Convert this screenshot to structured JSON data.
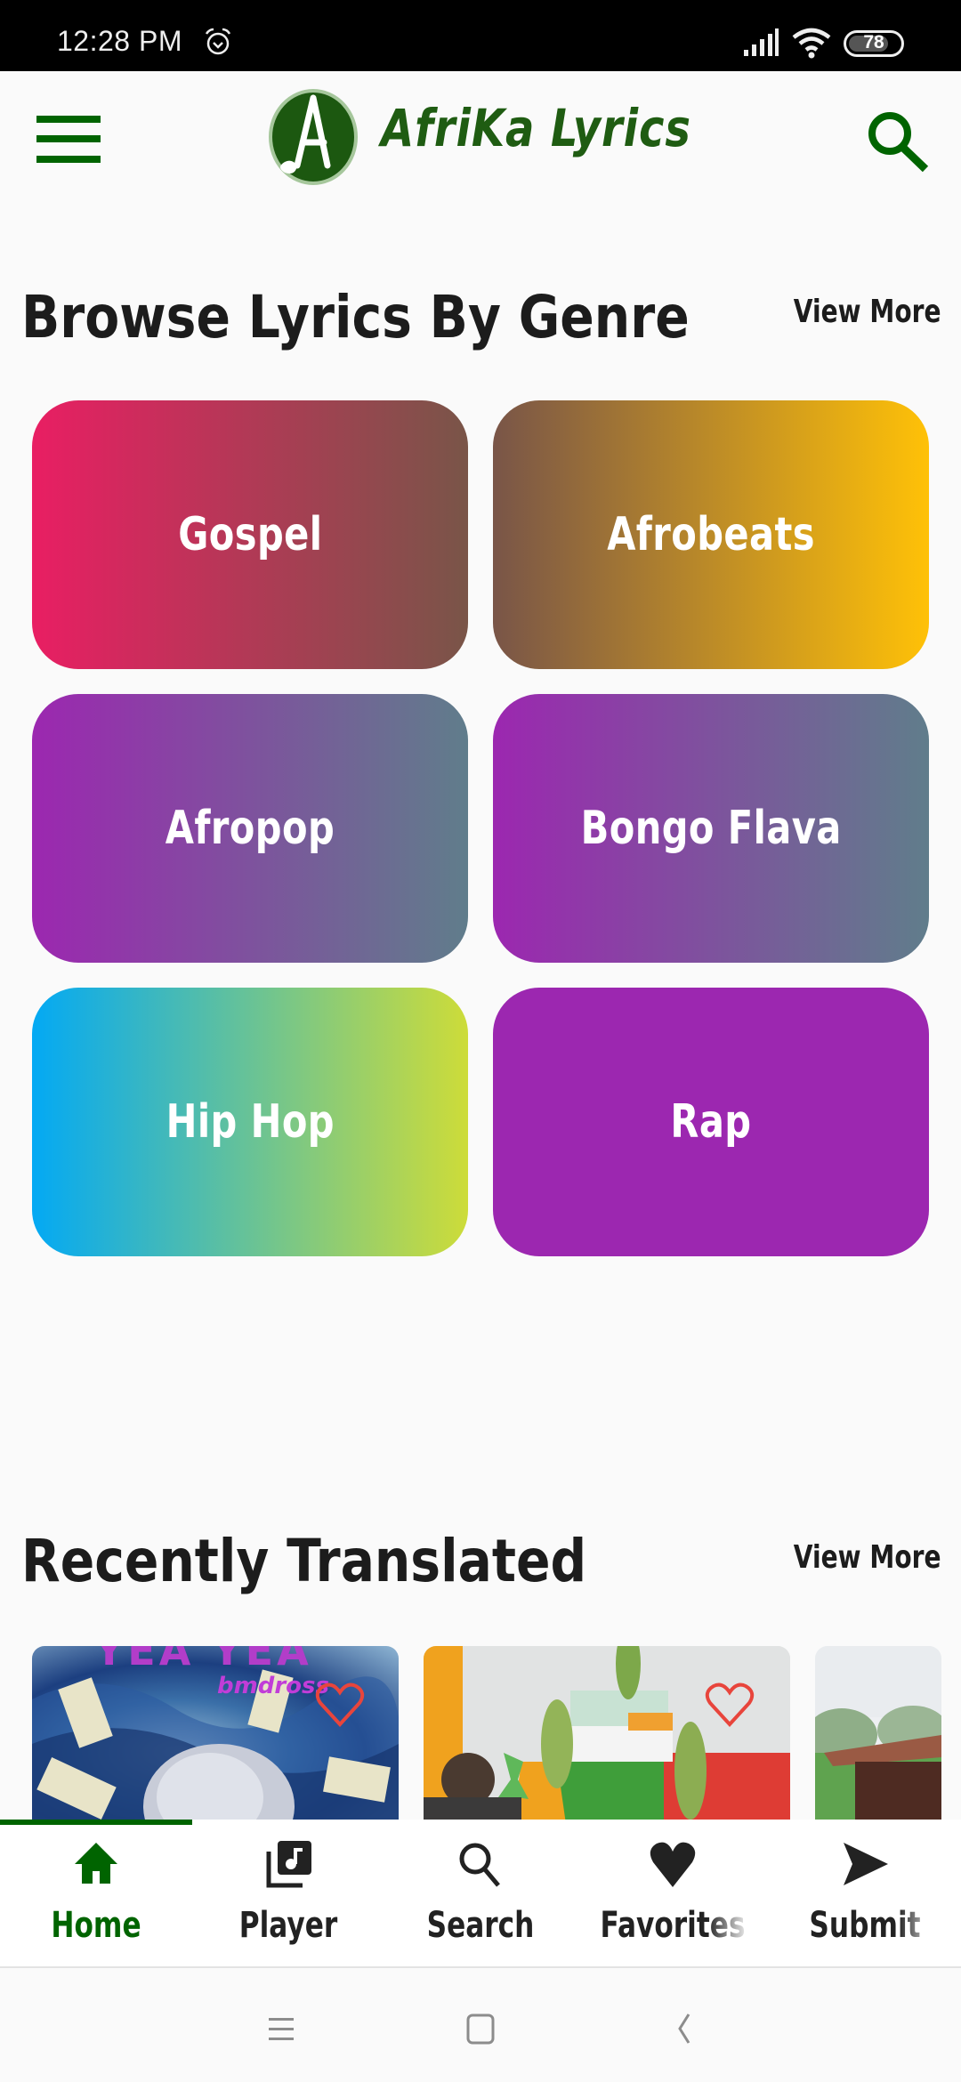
{
  "status_bar": {
    "time": "12:28 PM",
    "battery_level": "78",
    "icons": [
      "alarm-icon",
      "signal-icon",
      "wifi-icon",
      "battery-icon"
    ]
  },
  "app_bar": {
    "title": "AfriKa Lyrics",
    "logo_letter": "A",
    "menu_icon": "hamburger-menu-icon",
    "search_icon": "search-icon"
  },
  "genres_section": {
    "title": "Browse Lyrics By Genre",
    "view_more": "View More",
    "items": [
      {
        "label": "Gospel",
        "gradient": [
          "#e91e63",
          "#795548"
        ]
      },
      {
        "label": "Afrobeats",
        "gradient": [
          "#795548",
          "#ffc107"
        ]
      },
      {
        "label": "Afropop",
        "gradient": [
          "#9c27b0",
          "#607d8b"
        ]
      },
      {
        "label": "Bongo Flava",
        "gradient": [
          "#9c27b0",
          "#607d8b"
        ]
      },
      {
        "label": "Hip Hop",
        "gradient": [
          "#03a9f4",
          "#cddc39"
        ]
      },
      {
        "label": "Rap",
        "gradient": [
          "#9c27b0",
          "#9c27b0"
        ]
      }
    ]
  },
  "recent_section": {
    "title": "Recently Translated",
    "view_more": "View More",
    "items": [
      {
        "artwork_text": "YEA YEA",
        "artwork_subtext": "bmdross",
        "favorite_icon": "heart-outline-icon"
      },
      {
        "artwork_text": "",
        "artwork_subtext": "",
        "favorite_icon": "heart-outline-icon"
      },
      {
        "artwork_text": "",
        "artwork_subtext": "",
        "favorite_icon": ""
      }
    ]
  },
  "bottom_nav": {
    "active_color": "#006400",
    "items": [
      {
        "label": "Home",
        "icon": "home-icon",
        "active": true
      },
      {
        "label": "Player",
        "icon": "music-library-icon",
        "active": false
      },
      {
        "label": "Search",
        "icon": "search-icon",
        "active": false
      },
      {
        "label": "Favorites",
        "icon": "heart-icon",
        "active": false
      },
      {
        "label": "Submit",
        "icon": "send-icon",
        "active": false
      }
    ]
  },
  "system_nav": {
    "buttons": [
      "recents-icon",
      "home-square-icon",
      "back-icon"
    ]
  }
}
